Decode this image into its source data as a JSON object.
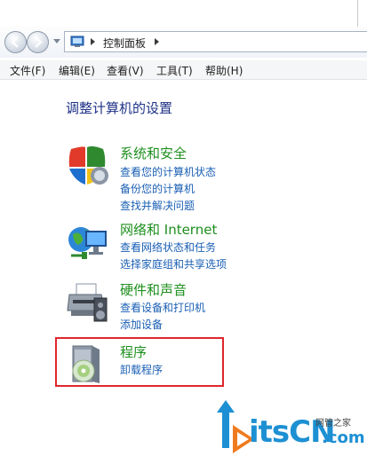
{
  "address_bar": {
    "crumbs": [
      "控制面板"
    ]
  },
  "menu": {
    "items": [
      "文件(F)",
      "编辑(E)",
      "查看(V)",
      "工具(T)",
      "帮助(H)"
    ]
  },
  "main": {
    "heading": "调整计算机的设置",
    "categories": [
      {
        "title": "系统和安全",
        "icon": "shield-icon",
        "links": [
          "查看您的计算机状态",
          "备份您的计算机",
          "查找并解决问题"
        ]
      },
      {
        "title": "网络和 Internet",
        "icon": "network-globe-icon",
        "links": [
          "查看网络状态和任务",
          "选择家庭组和共享选项"
        ]
      },
      {
        "title": "硬件和声音",
        "icon": "printer-speaker-icon",
        "links": [
          "查看设备和打印机",
          "添加设备"
        ]
      },
      {
        "title": "程序",
        "icon": "programs-disc-icon",
        "links": [
          "卸载程序"
        ]
      }
    ]
  },
  "watermark": {
    "text": "itsCN",
    "small": "网管之家",
    "domain": ".com"
  },
  "colors": {
    "category_title": "#1e8f1e",
    "link": "#1a5fb4",
    "heading": "#1e3287",
    "highlight": "#e0262b"
  }
}
